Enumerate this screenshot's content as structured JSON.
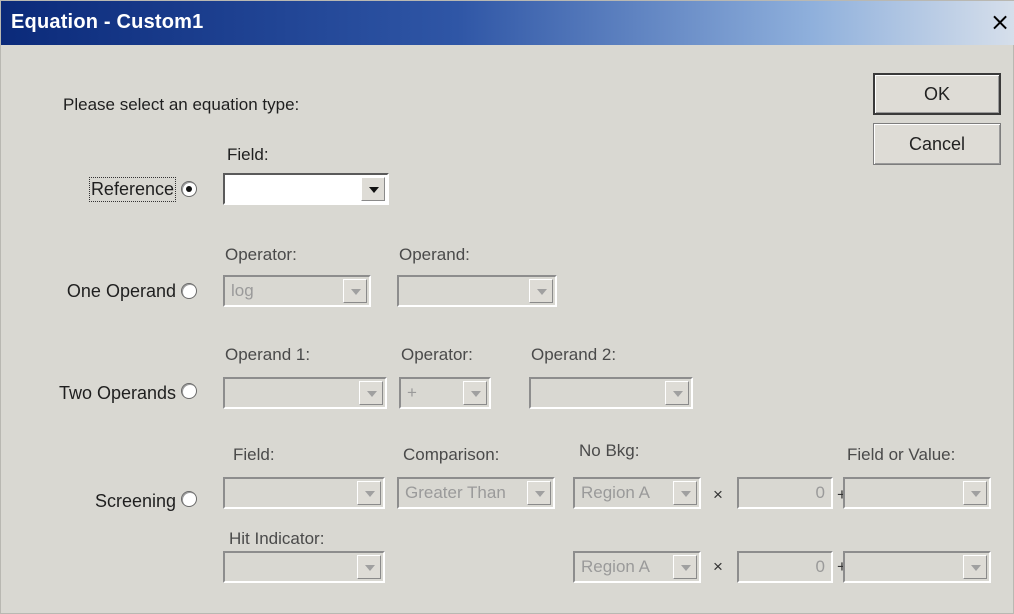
{
  "window": {
    "title": "Equation - Custom1",
    "close_glyph": "×"
  },
  "buttons": {
    "ok": "OK",
    "cancel": "Cancel"
  },
  "prompt": "Please select an equation type:",
  "reference": {
    "radio_label": "Reference",
    "selected": true,
    "field_label": "Field:",
    "field_value": ""
  },
  "one_operand": {
    "radio_label": "One Operand",
    "operator_label": "Operator:",
    "operator_value": "log",
    "operand_label": "Operand:",
    "operand_value": ""
  },
  "two_operands": {
    "radio_label": "Two Operands",
    "operand1_label": "Operand 1:",
    "operand1_value": "",
    "operator_label": "Operator:",
    "operator_value": "+",
    "operand2_label": "Operand 2:",
    "operand2_value": ""
  },
  "screening": {
    "radio_label": "Screening",
    "field_label": "Field:",
    "field_value": "",
    "comparison_label": "Comparison:",
    "comparison_value": "Greater Than",
    "no_bkg_label": "No Bkg:",
    "field_or_value_label": "Field or Value:",
    "hit_indicator_label": "Hit Indicator:",
    "hit_indicator_value": "",
    "row1": {
      "region": "Region A",
      "times": "×",
      "factor": "0",
      "plus": "+",
      "field_or_value": ""
    },
    "row2": {
      "region": "Region A",
      "times": "×",
      "factor": "0",
      "plus": "+",
      "field_or_value": ""
    }
  }
}
